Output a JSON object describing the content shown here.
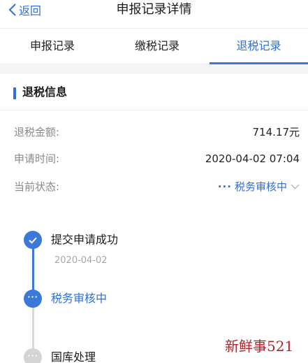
{
  "nav": {
    "back_label": "返回",
    "title": "申报记录详情"
  },
  "tabs": [
    {
      "label": "申报记录",
      "active": false
    },
    {
      "label": "缴税记录",
      "active": false
    },
    {
      "label": "退税记录",
      "active": true
    }
  ],
  "section": {
    "title": "退税信息"
  },
  "details": {
    "amount_label": "退税金额:",
    "amount_value": "714.17元",
    "time_label": "申请时间:",
    "time_value": "2020-04-02 07:04",
    "status_label": "当前状态:",
    "status_value": "税务审核中"
  },
  "timeline": [
    {
      "label": "提交申请成功",
      "date": "2020-04-02",
      "state": "done"
    },
    {
      "label": "税务审核中",
      "state": "current"
    },
    {
      "label": "国库处理",
      "state": "pending"
    }
  ],
  "watermark": "新鲜事521",
  "colors": {
    "accent": "#2f6fd6",
    "pending": "#d4d4d4",
    "label_gray": "#8a8a8a"
  },
  "icons": [
    "chevron-left-icon",
    "check-icon",
    "chevron-down-icon",
    "ellipsis-icon"
  ]
}
